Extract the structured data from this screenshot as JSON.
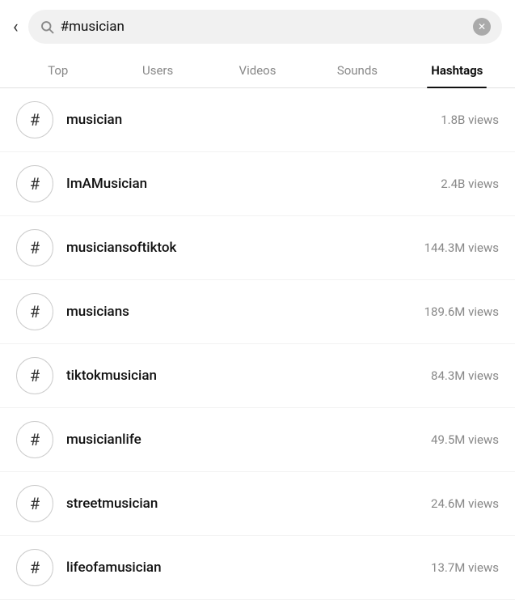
{
  "header": {
    "back_label": "‹",
    "search_query": "#musician",
    "clear_label": "✕"
  },
  "tabs": [
    {
      "id": "top",
      "label": "Top",
      "active": false
    },
    {
      "id": "users",
      "label": "Users",
      "active": false
    },
    {
      "id": "videos",
      "label": "Videos",
      "active": false
    },
    {
      "id": "sounds",
      "label": "Sounds",
      "active": false
    },
    {
      "id": "hashtags",
      "label": "Hashtags",
      "active": true
    }
  ],
  "hashtags": [
    {
      "name": "musician",
      "views": "1.8B views"
    },
    {
      "name": "ImAMusician",
      "views": "2.4B views"
    },
    {
      "name": "musiciansoftiktok",
      "views": "144.3M views"
    },
    {
      "name": "musicians",
      "views": "189.6M views"
    },
    {
      "name": "tiktokmusician",
      "views": "84.3M views"
    },
    {
      "name": "musicianlife",
      "views": "49.5M views"
    },
    {
      "name": "streetmusician",
      "views": "24.6M views"
    },
    {
      "name": "lifeofamusician",
      "views": "13.7M views"
    }
  ],
  "icons": {
    "hashtag": "#",
    "search": "🔍"
  }
}
